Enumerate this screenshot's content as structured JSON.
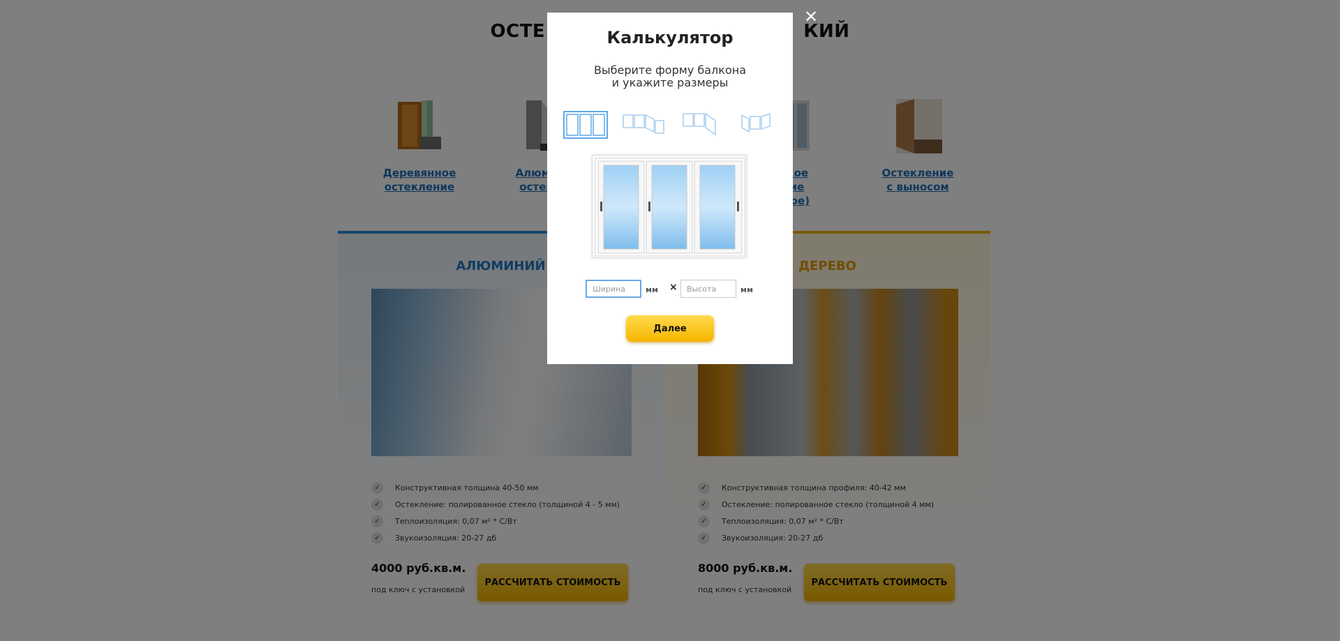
{
  "page": {
    "title_left": "ОСТЕ",
    "title_right": "КИЙ",
    "types": [
      {
        "label_line1": "Деревянное",
        "label_line2": "остекление"
      },
      {
        "label_line1": "Алюмини",
        "label_line2": "остекле"
      },
      {
        "label_line1": "узское",
        "label_line2": "ление",
        "label_line3": "амное)"
      },
      {
        "label_line1": "Остекление",
        "label_line2": "с выносом"
      }
    ],
    "panels": [
      {
        "title": "АЛЮМИНИЙ",
        "features": [
          "Конструктивная толщина 40-50 мм",
          "Остекление: полированное стекло (толщиной 4 - 5 мм)",
          "Теплоизоляция: 0,07 м² * С/Вт",
          "Звукоизоляция: 20-27 дб"
        ],
        "price": "4000 руб.кв.м.",
        "price_note": "под ключ с установкой",
        "button": "РАССЧИТАТЬ СТОИМОСТЬ"
      },
      {
        "title": "ДЕРЕВО",
        "features": [
          "Конструктивная толщина профиля: 40-42 мм",
          "Остекление: полированное стекло (толщиной 4 мм)",
          "Теплоизоляция: 0,07 м² * С/Вт",
          "Звукоизоляция: 20-27 дб"
        ],
        "price": "8000 руб.кв.м.",
        "price_note": "под ключ с установкой",
        "button": "РАССЧИТАТЬ СТОИМОСТЬ"
      }
    ]
  },
  "modal": {
    "close": "✕",
    "title": "Калькулятор",
    "subtitle_line1": "Выберите форму балкона",
    "subtitle_line2": "и укажите размеры",
    "shape_icons": [
      "straight-balcony-icon",
      "l-shape-balcony-icon",
      "angled-balcony-icon",
      "u-shape-balcony-icon"
    ],
    "width_placeholder": "Ширина",
    "height_placeholder": "Высота",
    "unit": "мм",
    "times": "×",
    "next_button": "Далее"
  },
  "colors": {
    "accent_blue": "#1e77c2",
    "accent_yellow": "#f5b400",
    "link": "#1e6fb5"
  }
}
